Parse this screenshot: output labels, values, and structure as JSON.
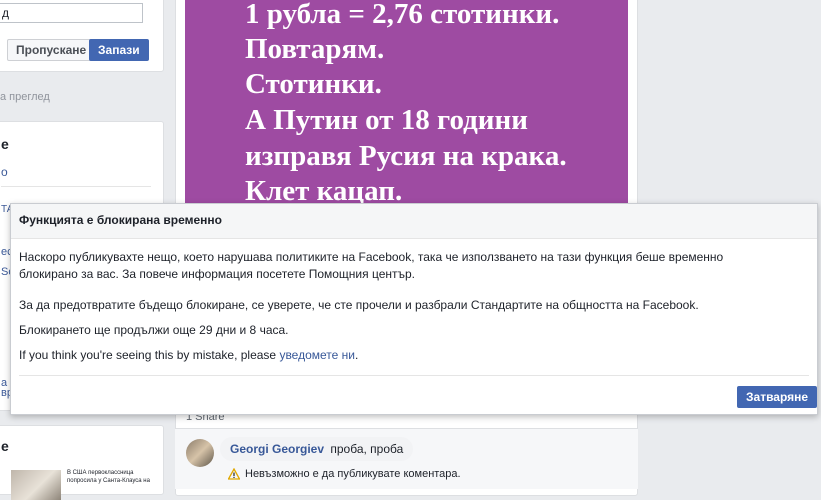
{
  "left": {
    "input_value": "д",
    "skip_label": "Пропускане",
    "save_label": "Запази",
    "preview_text": "а преглед",
    "section_heading": "е",
    "link_frag": "о",
    "frags": [
      "ТА",
      "ес",
      "Sc",
      "а",
      "вр"
    ],
    "thumb_caption_1": "В США первоклассница",
    "thumb_caption_2": "попросила у Санта-Клауса на"
  },
  "post": {
    "lines": [
      "1 рубла = 2,76 стотинки.",
      "Повтарям.",
      "Стотинки.",
      "А Путин от 18 години",
      "изправя Русия на крака.",
      "Клет кацап."
    ],
    "share_count": "1 Share"
  },
  "comment": {
    "author": "Georgi Georgiev",
    "text": "проба, проба",
    "warning": "Невъзможно е да публикувате коментара."
  },
  "modal": {
    "title": "Функцията е блокирана временно",
    "p1_line1": "Наскоро публикувахте нещо, което нарушава политиките на Facebook, така че използването на тази функция беше временно",
    "p1_line2": "блокирано за вас. За повече информация посетете Помощния център.",
    "p2": "За да предотвратите бъдещо блокиране, се уверете, че сте прочели и разбрали Стандартите на общността на Facebook.",
    "p3": "Блокирането ще продължи още 29 дни и 8 часа.",
    "p4_prefix": "If you think you're seeing this by mistake, please",
    "p4_link": "уведомете ни",
    "p4_suffix": ".",
    "close_label": "Затваряне"
  }
}
